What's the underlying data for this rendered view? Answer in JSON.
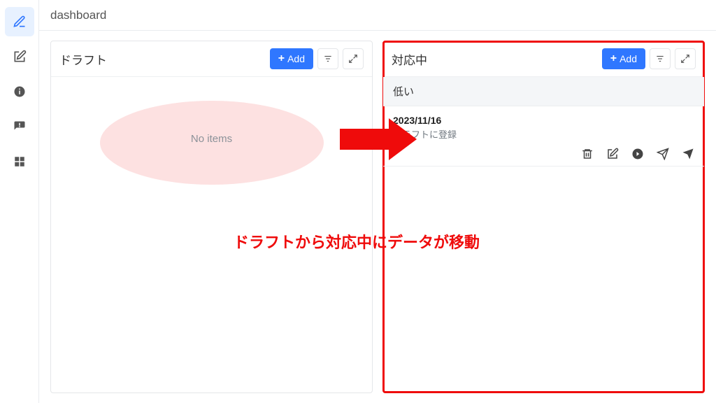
{
  "page_title": "dashboard",
  "add_button_label": "Add",
  "sidebar": {
    "items": [
      {
        "name": "compose",
        "active": true
      },
      {
        "name": "edit",
        "active": false
      },
      {
        "name": "info",
        "active": false
      },
      {
        "name": "feedback",
        "active": false
      },
      {
        "name": "dashboard",
        "active": false
      }
    ]
  },
  "panels": {
    "draft": {
      "title": "ドラフト",
      "empty_text": "No items"
    },
    "inprogress": {
      "title": "対応中",
      "group_label": "低い",
      "card": {
        "date": "2023/11/16",
        "subtitle": "ドラフトに登録"
      }
    }
  },
  "annotation_caption": "ドラフトから対応中にデータが移動"
}
